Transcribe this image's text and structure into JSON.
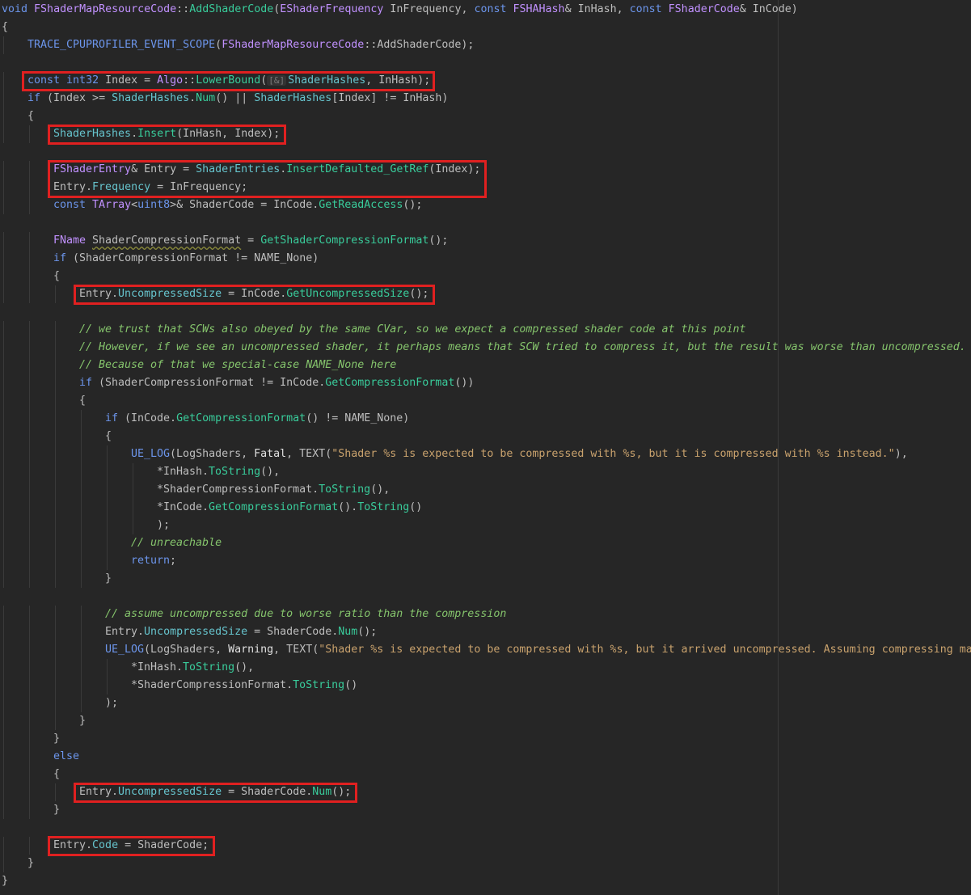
{
  "lines": [
    {
      "indent": 0,
      "tokens": [
        [
          "kw",
          "void"
        ],
        [
          "var",
          " "
        ],
        [
          "ty",
          "FShaderMapResourceCode"
        ],
        [
          "var",
          "::"
        ],
        [
          "fn",
          "AddShaderCode"
        ],
        [
          "var",
          "("
        ],
        [
          "ty",
          "EShaderFrequency"
        ],
        [
          "var",
          " "
        ],
        [
          "var",
          "InFrequency"
        ],
        [
          "var",
          ", "
        ],
        [
          "kw",
          "const"
        ],
        [
          "var",
          " "
        ],
        [
          "ty",
          "FSHAHash"
        ],
        [
          "var",
          "& InHash, "
        ],
        [
          "kw",
          "const"
        ],
        [
          "var",
          " "
        ],
        [
          "ty",
          "FShaderCode"
        ],
        [
          "var",
          "& InCode)"
        ]
      ]
    },
    {
      "indent": 0,
      "tokens": [
        [
          "var",
          "{"
        ]
      ]
    },
    {
      "indent": 1,
      "tokens": [
        [
          "mac",
          "TRACE_CPUPROFILER_EVENT_SCOPE"
        ],
        [
          "var",
          "("
        ],
        [
          "ty",
          "FShaderMapResourceCode"
        ],
        [
          "var",
          "::AddShaderCode);"
        ]
      ]
    },
    {
      "indent": 0,
      "tokens": []
    },
    {
      "indent": 1,
      "tokens": [
        [
          "kw",
          "const"
        ],
        [
          "var",
          " "
        ],
        [
          "kw",
          "int32"
        ],
        [
          "var",
          " Index = "
        ],
        [
          "ns",
          "Algo"
        ],
        [
          "var",
          "::"
        ],
        [
          "fn",
          "LowerBound"
        ],
        [
          "var",
          "("
        ],
        [
          "hint",
          "[&]"
        ],
        [
          "mem",
          "ShaderHashes"
        ],
        [
          "var",
          ", InHash);"
        ]
      ]
    },
    {
      "indent": 1,
      "tokens": [
        [
          "kw",
          "if"
        ],
        [
          "var",
          " (Index >= "
        ],
        [
          "mem",
          "ShaderHashes"
        ],
        [
          "var",
          "."
        ],
        [
          "fn",
          "Num"
        ],
        [
          "var",
          "() || "
        ],
        [
          "mem",
          "ShaderHashes"
        ],
        [
          "var",
          "[Index] != InHash)"
        ]
      ]
    },
    {
      "indent": 1,
      "tokens": [
        [
          "var",
          "{"
        ]
      ]
    },
    {
      "indent": 2,
      "tokens": [
        [
          "mem",
          "ShaderHashes"
        ],
        [
          "var",
          "."
        ],
        [
          "fn",
          "Insert"
        ],
        [
          "var",
          "(InHash, Index);"
        ]
      ]
    },
    {
      "indent": 0,
      "tokens": []
    },
    {
      "indent": 2,
      "tokens": [
        [
          "ty",
          "FShaderEntry"
        ],
        [
          "var",
          "& Entry = "
        ],
        [
          "mem",
          "ShaderEntries"
        ],
        [
          "var",
          "."
        ],
        [
          "fn",
          "InsertDefaulted_GetRef"
        ],
        [
          "var",
          "(Index);"
        ]
      ]
    },
    {
      "indent": 2,
      "tokens": [
        [
          "var",
          "Entry."
        ],
        [
          "fld",
          "Frequency"
        ],
        [
          "var",
          " = InFrequency;"
        ]
      ]
    },
    {
      "indent": 2,
      "tokens": [
        [
          "kw",
          "const"
        ],
        [
          "var",
          " "
        ],
        [
          "ty",
          "TArray"
        ],
        [
          "var",
          "<"
        ],
        [
          "kw",
          "uint8"
        ],
        [
          "var",
          ">& ShaderCode = InCode."
        ],
        [
          "fn",
          "GetReadAccess"
        ],
        [
          "var",
          "();"
        ]
      ]
    },
    {
      "indent": 0,
      "tokens": []
    },
    {
      "indent": 2,
      "tokens": [
        [
          "ty",
          "FName"
        ],
        [
          "var",
          " "
        ],
        [
          "und",
          "ShaderCompressionFormat"
        ],
        [
          "var",
          " = "
        ],
        [
          "fn",
          "GetShaderCompressionFormat"
        ],
        [
          "var",
          "();"
        ]
      ]
    },
    {
      "indent": 2,
      "tokens": [
        [
          "kw",
          "if"
        ],
        [
          "var",
          " (ShaderCompressionFormat != NAME_None)"
        ]
      ]
    },
    {
      "indent": 2,
      "tokens": [
        [
          "var",
          "{"
        ]
      ]
    },
    {
      "indent": 3,
      "tokens": [
        [
          "var",
          "Entry."
        ],
        [
          "fld",
          "UncompressedSize"
        ],
        [
          "var",
          " = InCode."
        ],
        [
          "fn",
          "GetUncompressedSize"
        ],
        [
          "var",
          "();"
        ]
      ]
    },
    {
      "indent": 0,
      "tokens": []
    },
    {
      "indent": 3,
      "tokens": [
        [
          "cm",
          "// we trust that SCWs also obeyed by the same CVar, so we expect a compressed shader code at this point"
        ]
      ]
    },
    {
      "indent": 3,
      "tokens": [
        [
          "cm",
          "// However, if we see an uncompressed shader, it perhaps means that SCW tried to compress it, but the result was worse than uncompressed."
        ]
      ]
    },
    {
      "indent": 3,
      "tokens": [
        [
          "cm",
          "// Because of that we special-case NAME_None here"
        ]
      ]
    },
    {
      "indent": 3,
      "tokens": [
        [
          "kw",
          "if"
        ],
        [
          "var",
          " (ShaderCompressionFormat != InCode."
        ],
        [
          "fn",
          "GetCompressionFormat"
        ],
        [
          "var",
          "())"
        ]
      ]
    },
    {
      "indent": 3,
      "tokens": [
        [
          "var",
          "{"
        ]
      ]
    },
    {
      "indent": 4,
      "tokens": [
        [
          "kw",
          "if"
        ],
        [
          "var",
          " (InCode."
        ],
        [
          "fn",
          "GetCompressionFormat"
        ],
        [
          "var",
          "() != NAME_None)"
        ]
      ]
    },
    {
      "indent": 4,
      "tokens": [
        [
          "var",
          "{"
        ]
      ]
    },
    {
      "indent": 5,
      "tokens": [
        [
          "mac",
          "UE_LOG"
        ],
        [
          "var",
          "(LogShaders, "
        ],
        [
          "enum",
          "Fatal"
        ],
        [
          "var",
          ", TEXT("
        ],
        [
          "str",
          "\"Shader %s is expected to be compressed with %s, but it is compressed with %s instead.\""
        ],
        [
          "var",
          "),"
        ]
      ]
    },
    {
      "indent": 6,
      "tokens": [
        [
          "var",
          "*InHash."
        ],
        [
          "fn",
          "ToString"
        ],
        [
          "var",
          "(),"
        ]
      ]
    },
    {
      "indent": 6,
      "tokens": [
        [
          "var",
          "*ShaderCompressionFormat."
        ],
        [
          "fn",
          "ToString"
        ],
        [
          "var",
          "(),"
        ]
      ]
    },
    {
      "indent": 6,
      "tokens": [
        [
          "var",
          "*InCode."
        ],
        [
          "fn",
          "GetCompressionFormat"
        ],
        [
          "var",
          "()."
        ],
        [
          "fn",
          "ToString"
        ],
        [
          "var",
          "()"
        ]
      ]
    },
    {
      "indent": 6,
      "tokens": [
        [
          "var",
          ");"
        ]
      ]
    },
    {
      "indent": 5,
      "tokens": [
        [
          "cm",
          "// unreachable"
        ]
      ]
    },
    {
      "indent": 5,
      "tokens": [
        [
          "kw",
          "return"
        ],
        [
          "var",
          ";"
        ]
      ]
    },
    {
      "indent": 4,
      "tokens": [
        [
          "var",
          "}"
        ]
      ]
    },
    {
      "indent": 0,
      "tokens": []
    },
    {
      "indent": 4,
      "tokens": [
        [
          "cm",
          "// assume uncompressed due to worse ratio than the compression"
        ]
      ]
    },
    {
      "indent": 4,
      "tokens": [
        [
          "var",
          "Entry."
        ],
        [
          "fld",
          "UncompressedSize"
        ],
        [
          "var",
          " = ShaderCode."
        ],
        [
          "fn",
          "Num"
        ],
        [
          "var",
          "();"
        ]
      ]
    },
    {
      "indent": 4,
      "tokens": [
        [
          "mac",
          "UE_LOG"
        ],
        [
          "var",
          "(LogShaders, "
        ],
        [
          "enum",
          "Warning"
        ],
        [
          "var",
          ", TEXT("
        ],
        [
          "str",
          "\"Shader %s is expected to be compressed with %s, but it arrived uncompressed. Assuming compressing ma"
        ]
      ]
    },
    {
      "indent": 5,
      "tokens": [
        [
          "var",
          "*InHash."
        ],
        [
          "fn",
          "ToString"
        ],
        [
          "var",
          "(),"
        ]
      ]
    },
    {
      "indent": 5,
      "tokens": [
        [
          "var",
          "*ShaderCompressionFormat."
        ],
        [
          "fn",
          "ToString"
        ],
        [
          "var",
          "()"
        ]
      ]
    },
    {
      "indent": 4,
      "tokens": [
        [
          "var",
          ");"
        ]
      ]
    },
    {
      "indent": 3,
      "tokens": [
        [
          "var",
          "}"
        ]
      ]
    },
    {
      "indent": 2,
      "tokens": [
        [
          "var",
          "}"
        ]
      ]
    },
    {
      "indent": 2,
      "tokens": [
        [
          "kw",
          "else"
        ]
      ]
    },
    {
      "indent": 2,
      "tokens": [
        [
          "var",
          "{"
        ]
      ]
    },
    {
      "indent": 3,
      "tokens": [
        [
          "var",
          "Entry."
        ],
        [
          "fld",
          "UncompressedSize"
        ],
        [
          "var",
          " = ShaderCode."
        ],
        [
          "fn",
          "Num"
        ],
        [
          "var",
          "();"
        ]
      ]
    },
    {
      "indent": 2,
      "tokens": [
        [
          "var",
          "}"
        ]
      ]
    },
    {
      "indent": 0,
      "tokens": []
    },
    {
      "indent": 2,
      "tokens": [
        [
          "var",
          "Entry."
        ],
        [
          "fld",
          "Code"
        ],
        [
          "var",
          " = ShaderCode;"
        ]
      ]
    },
    {
      "indent": 1,
      "tokens": [
        [
          "var",
          "}"
        ]
      ]
    },
    {
      "indent": 0,
      "tokens": [
        [
          "var",
          "}"
        ]
      ]
    }
  ],
  "highlight_boxes": [
    {
      "name": "highlight-lowerbound-line",
      "lines": [
        4,
        4
      ]
    },
    {
      "name": "highlight-insert-line",
      "lines": [
        7,
        7
      ]
    },
    {
      "name": "highlight-entry-frequency-lines",
      "lines": [
        9,
        10
      ]
    },
    {
      "name": "highlight-uncompressed-size-compressed",
      "lines": [
        16,
        16
      ]
    },
    {
      "name": "highlight-uncompressed-size-else",
      "lines": [
        44,
        44
      ]
    },
    {
      "name": "highlight-entry-code-line",
      "lines": [
        47,
        47
      ]
    }
  ],
  "colors": {
    "background": "#262626",
    "keyword": "#6c95eb",
    "type": "#c191ff",
    "function": "#39cc9b",
    "member": "#66c3cc",
    "string": "#c9a26d",
    "comment": "#85c46c",
    "highlight": "#e02020"
  }
}
